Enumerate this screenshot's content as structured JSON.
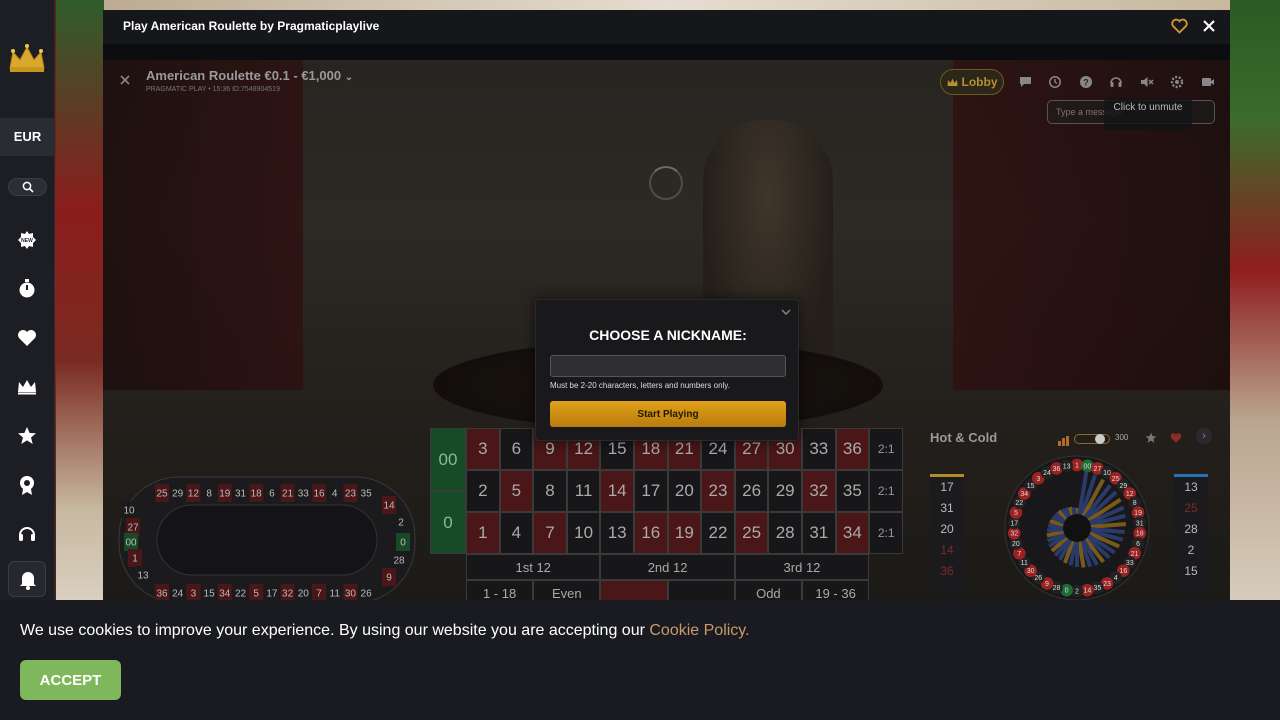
{
  "sidebar": {
    "currency": "EUR",
    "icons": [
      "crown-logo-icon",
      "search-icon",
      "new-badge-icon",
      "stopwatch-icon",
      "heart-icon",
      "crown-icon",
      "star-icon",
      "trophy-icon",
      "headset-icon",
      "bell-icon"
    ]
  },
  "game_window": {
    "title": "Play American Roulette by Pragmaticplaylive",
    "video": {
      "table_title": "American Roulette €0.1 - €1,000",
      "table_subtitle": "PRAGMATIC PLAY • 15:36 ID:7548904519",
      "lobby_label": "Lobby",
      "chat_placeholder": "Type a message",
      "unmute_tooltip": "Click to unmute"
    },
    "betting_grid": {
      "zeros": [
        "00",
        "0"
      ],
      "rows": [
        [
          {
            "n": "3",
            "c": "r"
          },
          {
            "n": "6",
            "c": "b"
          },
          {
            "n": "9",
            "c": "r"
          },
          {
            "n": "12",
            "c": "r"
          },
          {
            "n": "15",
            "c": "b"
          },
          {
            "n": "18",
            "c": "r"
          },
          {
            "n": "21",
            "c": "r"
          },
          {
            "n": "24",
            "c": "b"
          },
          {
            "n": "27",
            "c": "r"
          },
          {
            "n": "30",
            "c": "r"
          },
          {
            "n": "33",
            "c": "b"
          },
          {
            "n": "36",
            "c": "r"
          }
        ],
        [
          {
            "n": "2",
            "c": "b"
          },
          {
            "n": "5",
            "c": "r"
          },
          {
            "n": "8",
            "c": "b"
          },
          {
            "n": "11",
            "c": "b"
          },
          {
            "n": "14",
            "c": "r"
          },
          {
            "n": "17",
            "c": "b"
          },
          {
            "n": "20",
            "c": "b"
          },
          {
            "n": "23",
            "c": "r"
          },
          {
            "n": "26",
            "c": "b"
          },
          {
            "n": "29",
            "c": "b"
          },
          {
            "n": "32",
            "c": "r"
          },
          {
            "n": "35",
            "c": "b"
          }
        ],
        [
          {
            "n": "1",
            "c": "r"
          },
          {
            "n": "4",
            "c": "b"
          },
          {
            "n": "7",
            "c": "r"
          },
          {
            "n": "10",
            "c": "b"
          },
          {
            "n": "13",
            "c": "b"
          },
          {
            "n": "16",
            "c": "r"
          },
          {
            "n": "19",
            "c": "r"
          },
          {
            "n": "22",
            "c": "b"
          },
          {
            "n": "25",
            "c": "r"
          },
          {
            "n": "28",
            "c": "b"
          },
          {
            "n": "31",
            "c": "b"
          },
          {
            "n": "34",
            "c": "r"
          }
        ]
      ],
      "column_bets": [
        "2:1",
        "2:1",
        "2:1"
      ],
      "dozens": [
        "1st 12",
        "2nd 12",
        "3rd 12"
      ],
      "outside": [
        "1 - 18",
        "Even",
        "",
        "",
        "Odd",
        "19 - 36"
      ]
    },
    "racetrack": {
      "top": [
        "25",
        "29",
        "12",
        "8",
        "19",
        "31",
        "18",
        "6",
        "21",
        "33",
        "16",
        "4",
        "23",
        "35"
      ],
      "bottom": [
        "36",
        "24",
        "3",
        "15",
        "34",
        "22",
        "5",
        "17",
        "32",
        "20",
        "7",
        "11",
        "30",
        "26"
      ],
      "left": [
        "10",
        "27",
        "00",
        "1",
        "13"
      ],
      "right": [
        "14",
        "2",
        "0",
        "28",
        "9"
      ]
    },
    "hot_cold": {
      "title": "Hot & Cold",
      "slider_value": "300",
      "hot": [
        {
          "n": "17",
          "c": "b"
        },
        {
          "n": "31",
          "c": "b"
        },
        {
          "n": "20",
          "c": "b"
        },
        {
          "n": "14",
          "c": "r"
        },
        {
          "n": "36",
          "c": "r"
        }
      ],
      "cold": [
        {
          "n": "13",
          "c": "b"
        },
        {
          "n": "25",
          "c": "r"
        },
        {
          "n": "28",
          "c": "b"
        },
        {
          "n": "2",
          "c": "b"
        },
        {
          "n": "15",
          "c": "b"
        }
      ],
      "wheel_numbers": [
        "1",
        "00",
        "27",
        "10",
        "25",
        "29",
        "12",
        "8",
        "19",
        "31",
        "18",
        "6",
        "21",
        "33",
        "16",
        "4",
        "23",
        "35",
        "14",
        "2",
        "0",
        "28",
        "9",
        "26",
        "30",
        "11",
        "7",
        "20",
        "32",
        "17",
        "5",
        "22",
        "34",
        "15",
        "3",
        "24",
        "36",
        "13"
      ]
    },
    "modal": {
      "title": "CHOOSE A NICKNAME:",
      "input_value": "",
      "hint": "Must be 2-20 characters, letters and numbers only.",
      "button": "Start Playing"
    }
  },
  "cookie_banner": {
    "text": "We use cookies to improve your experience. By using our website you are accepting our ",
    "link": "Cookie Policy.",
    "accept": "ACCEPT"
  },
  "colors": {
    "accent_gold": "#e0a018",
    "accept_green": "#7fb85a",
    "link": "#c79a6b",
    "red_cell": "#4a1617",
    "green_zero": "#174a26"
  }
}
